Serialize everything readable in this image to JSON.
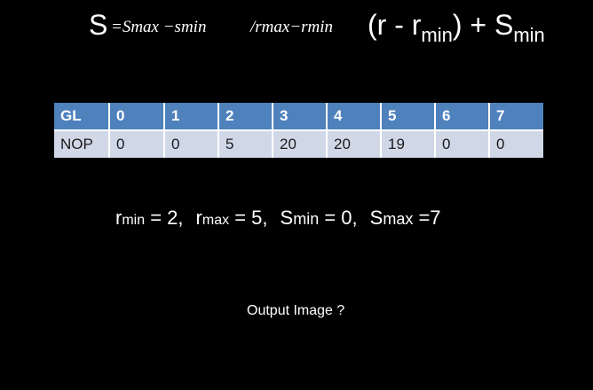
{
  "formula": {
    "s": "S",
    "eq_part": "=Smax −smin",
    "den_part": "/rmax−rmin",
    "paren_open": "(r - r",
    "r_sub": "min",
    "paren_close": ") + S",
    "s_sub": "min"
  },
  "table": {
    "header": [
      "GL",
      "0",
      "1",
      "2",
      "3",
      "4",
      "5",
      "6",
      "7"
    ],
    "row": [
      "NOP",
      "0",
      "0",
      "5",
      "20",
      "20",
      "19",
      "0",
      "0"
    ]
  },
  "params": {
    "r1": "r",
    "r1_sub": "min",
    "r1_val": " = 2,",
    "r2": "r",
    "r2_sub": "max",
    "r2_val": " = 5,",
    "s1": "S",
    "s1_sub": "min",
    "s1_val": " = 0,",
    "s2": "S",
    "s2_sub": "max",
    "s2_val": " =7"
  },
  "question": "Output Image ?",
  "colors": {
    "background": "#000000",
    "header_fill": "#4f81bd",
    "row_fill": "#d0d8e8",
    "text": "#ffffff"
  }
}
